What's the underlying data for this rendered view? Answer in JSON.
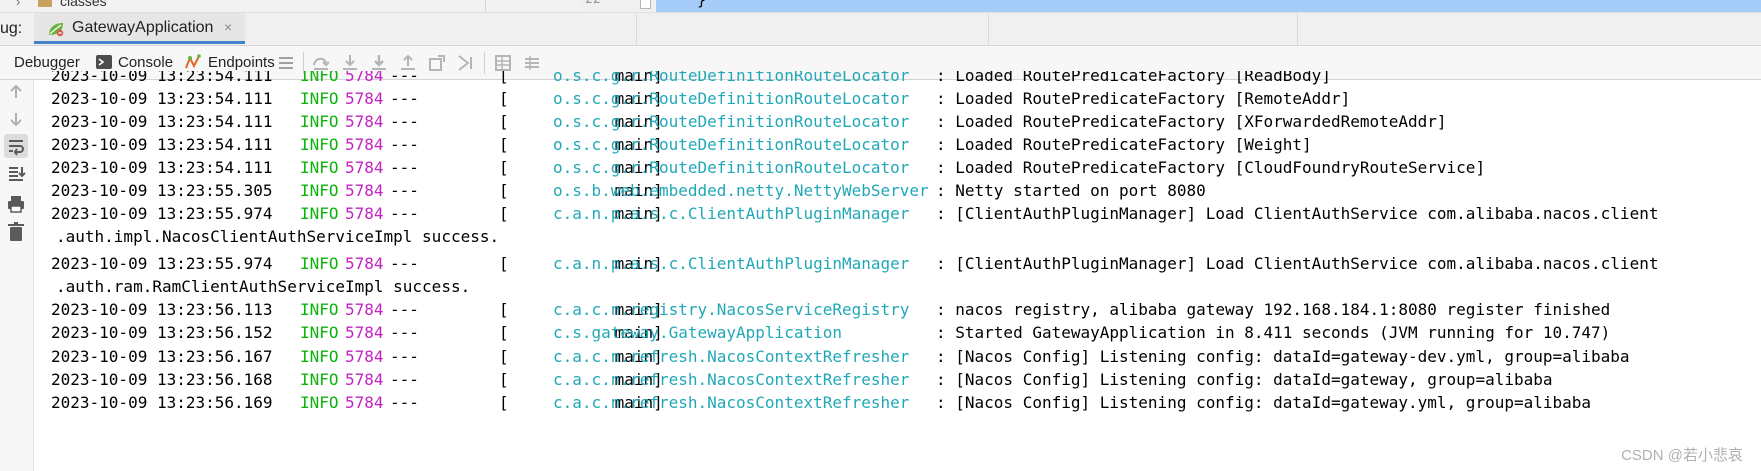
{
  "editor_strip": {
    "folder_name": "classes",
    "line_number": "22",
    "code_char": "}"
  },
  "debug_tabs": {
    "prefix": "ug:",
    "run_tab": {
      "label": "GatewayApplication",
      "close": "×",
      "icon": "spring-boot-icon"
    }
  },
  "toolbar": {
    "debugger_label": "Debugger",
    "console_label": "Console",
    "endpoints_label": "Endpoints",
    "icons": [
      "menu-icon",
      "step-over-icon",
      "step-into-icon",
      "force-step-into-icon",
      "step-out-icon",
      "drop-frame-icon",
      "run-to-cursor-icon",
      "evaluate-expression-icon",
      "trace-icon"
    ]
  },
  "side_toolbar": {
    "icons": [
      "up-arrow-icon",
      "down-arrow-icon",
      "soft-wrap-icon",
      "scroll-to-end-icon",
      "print-icon",
      "clear-all-icon"
    ]
  },
  "console": {
    "lines": [
      {
        "ts": "2023-10-09 13:23:54.111",
        "level": "INFO",
        "pid": "5784",
        "dash": "---",
        "thread": "[           main]",
        "logger": "o.s.c.g.r.RouteDefinitionRouteLocator",
        "msg": ": Loaded RoutePredicateFactory [ReadBody]"
      },
      {
        "ts": "2023-10-09 13:23:54.111",
        "level": "INFO",
        "pid": "5784",
        "dash": "---",
        "thread": "[           main]",
        "logger": "o.s.c.g.r.RouteDefinitionRouteLocator",
        "msg": ": Loaded RoutePredicateFactory [RemoteAddr]"
      },
      {
        "ts": "2023-10-09 13:23:54.111",
        "level": "INFO",
        "pid": "5784",
        "dash": "---",
        "thread": "[           main]",
        "logger": "o.s.c.g.r.RouteDefinitionRouteLocator",
        "msg": ": Loaded RoutePredicateFactory [XForwardedRemoteAddr]"
      },
      {
        "ts": "2023-10-09 13:23:54.111",
        "level": "INFO",
        "pid": "5784",
        "dash": "---",
        "thread": "[           main]",
        "logger": "o.s.c.g.r.RouteDefinitionRouteLocator",
        "msg": ": Loaded RoutePredicateFactory [Weight]"
      },
      {
        "ts": "2023-10-09 13:23:54.111",
        "level": "INFO",
        "pid": "5784",
        "dash": "---",
        "thread": "[           main]",
        "logger": "o.s.c.g.r.RouteDefinitionRouteLocator",
        "msg": ": Loaded RoutePredicateFactory [CloudFoundryRouteService]"
      },
      {
        "ts": "2023-10-09 13:23:55.305",
        "level": "INFO",
        "pid": "5784",
        "dash": "---",
        "thread": "[           main]",
        "logger": "o.s.b.web.embedded.netty.NettyWebServer",
        "msg": ": Netty started on port 8080"
      },
      {
        "ts": "2023-10-09 13:23:55.974",
        "level": "INFO",
        "pid": "5784",
        "dash": "---",
        "thread": "[           main]",
        "logger": "c.a.n.p.a.s.c.ClientAuthPluginManager",
        "msg": ": [ClientAuthPluginManager] Load ClientAuthService com.alibaba.nacos.client"
      },
      {
        "cont": ".auth.impl.NacosClientAuthServiceImpl success."
      },
      {
        "ts": "2023-10-09 13:23:55.974",
        "level": "INFO",
        "pid": "5784",
        "dash": "---",
        "thread": "[           main]",
        "logger": "c.a.n.p.a.s.c.ClientAuthPluginManager",
        "msg": ": [ClientAuthPluginManager] Load ClientAuthService com.alibaba.nacos.client"
      },
      {
        "cont": ".auth.ram.RamClientAuthServiceImpl success."
      },
      {
        "ts": "2023-10-09 13:23:56.113",
        "level": "INFO",
        "pid": "5784",
        "dash": "---",
        "thread": "[           main]",
        "logger": "c.a.c.n.registry.NacosServiceRegistry",
        "msg": ": nacos registry, alibaba gateway 192.168.184.1:8080 register finished"
      },
      {
        "ts": "2023-10-09 13:23:56.152",
        "level": "INFO",
        "pid": "5784",
        "dash": "---",
        "thread": "[           main]",
        "logger": "c.s.gateway.GatewayApplication",
        "msg": ": Started GatewayApplication in 8.411 seconds (JVM running for 10.747)"
      },
      {
        "ts": "2023-10-09 13:23:56.167",
        "level": "INFO",
        "pid": "5784",
        "dash": "---",
        "thread": "[           main]",
        "logger": "c.a.c.n.refresh.NacosContextRefresher",
        "msg": ": [Nacos Config] Listening config: dataId=gateway-dev.yml, group=alibaba"
      },
      {
        "ts": "2023-10-09 13:23:56.168",
        "level": "INFO",
        "pid": "5784",
        "dash": "---",
        "thread": "[           main]",
        "logger": "c.a.c.n.refresh.NacosContextRefresher",
        "msg": ": [Nacos Config] Listening config: dataId=gateway, group=alibaba"
      },
      {
        "ts": "2023-10-09 13:23:56.169",
        "level": "INFO",
        "pid": "5784",
        "dash": "---",
        "thread": "[           main]",
        "logger": "c.a.c.n.refresh.NacosContextRefresher",
        "msg": ": [Nacos Config] Listening config: dataId=gateway.yml, group=alibaba"
      }
    ]
  },
  "watermark": "CSDN @若小悲哀",
  "colors": {
    "level": "#0db30d",
    "pid": "#c223c2",
    "logger": "#21a8b8",
    "tab_underline": "#4083c9",
    "editor_highlight": "#a6cdfa"
  }
}
